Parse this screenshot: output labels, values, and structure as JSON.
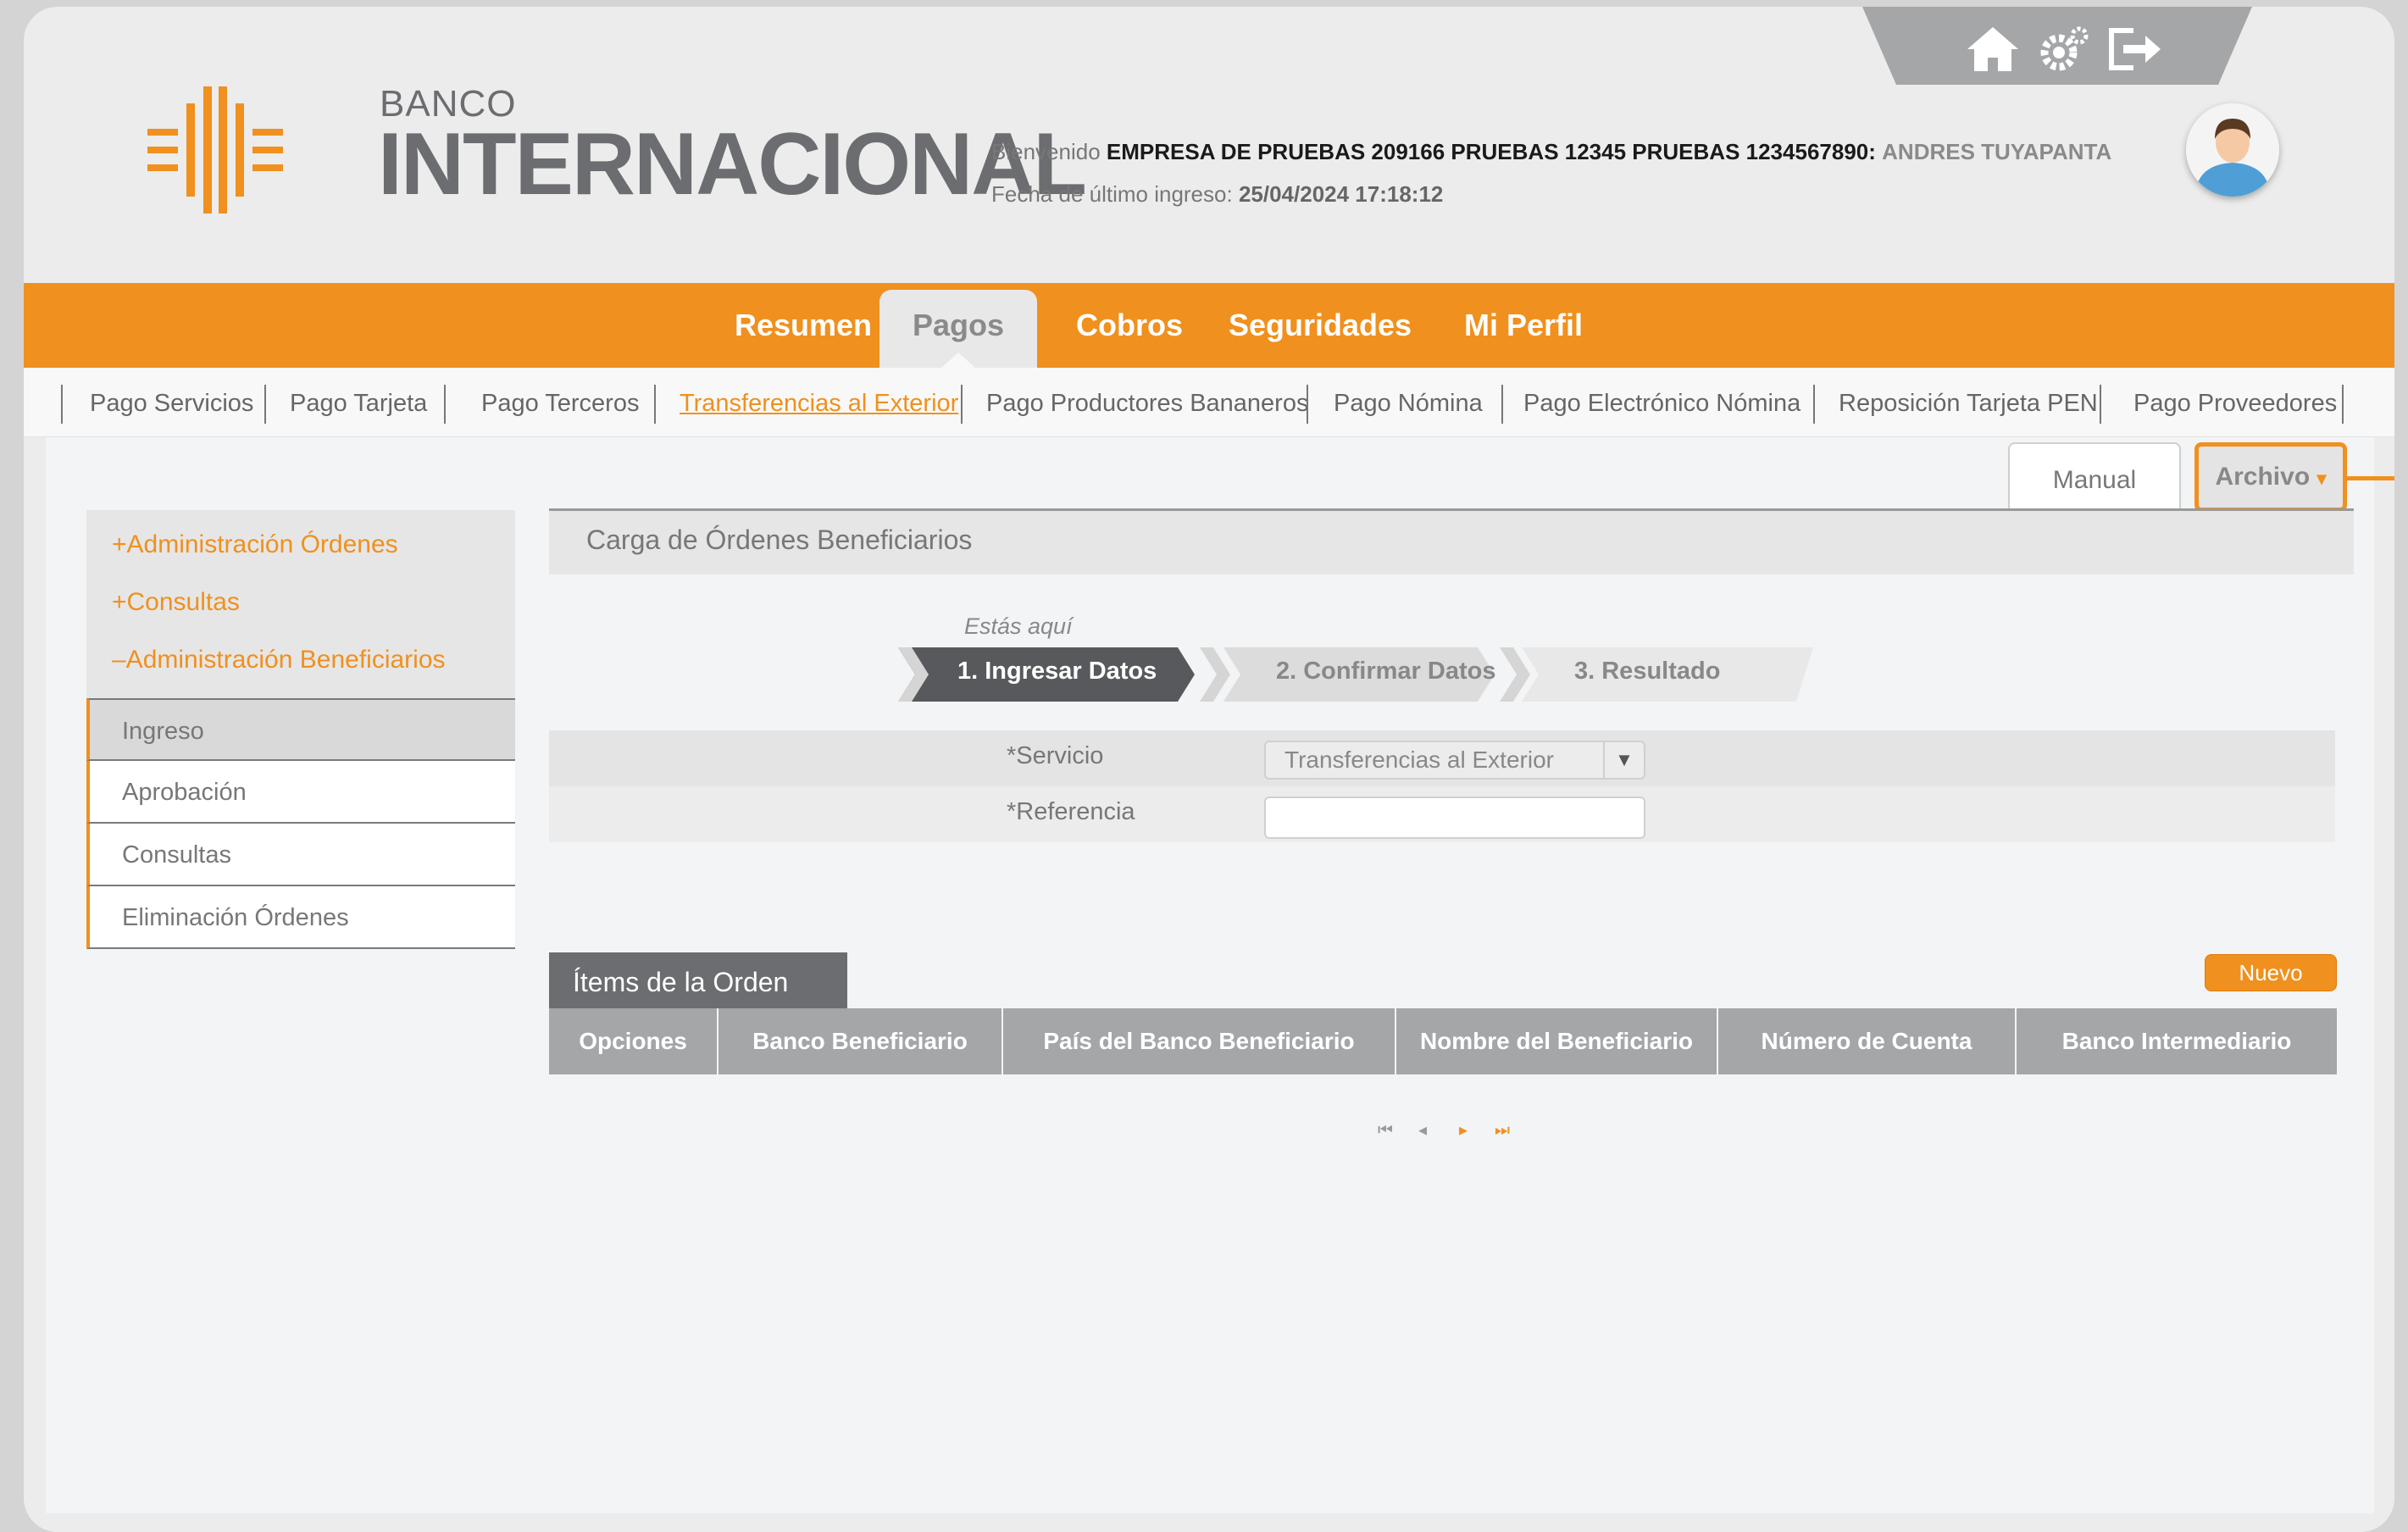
{
  "brand": {
    "line1": "BANCO",
    "line2": "INTERNACIONAL",
    "color_orange": "#f0901e",
    "color_gray": "#6c6d70"
  },
  "header": {
    "welcome_prefix": "Bienvenido",
    "company": "EMPRESA DE PRUEBAS 209166 PRUEBAS 12345 PRUEBAS 1234567890:",
    "user": "ANDRES TUYAPANTA",
    "last_login_label": "Fecha de último ingreso:",
    "last_login_value": "25/04/2024 17:18:12",
    "icons": [
      "home-icon",
      "settings-icon",
      "logout-icon"
    ]
  },
  "main_nav": {
    "items": [
      "Resumen",
      "Pagos",
      "Cobros",
      "Seguridades",
      "Mi Perfil"
    ],
    "active": "Pagos"
  },
  "sub_nav": {
    "items": [
      "Pago Servicios",
      "Pago Tarjeta",
      "Pago Terceros",
      "Transferencias al Exterior",
      "Pago Productores Bananeros",
      "Pago Nómina",
      "Pago Electrónico Nómina",
      "Reposición Tarjeta PEN",
      "Pago Proveedores"
    ],
    "active": "Transferencias al Exterior"
  },
  "tabs": {
    "manual": "Manual",
    "archivo": "Archivo",
    "archivo_caret": "▾"
  },
  "sidebar": {
    "sections": [
      "+Administración Órdenes",
      "+Consultas",
      "–Administración Beneficiarios"
    ],
    "menu": [
      "Ingreso",
      "Aprobación",
      "Consultas",
      "Eliminación Órdenes"
    ],
    "selected": "Ingreso"
  },
  "content": {
    "title": "Carga de Órdenes Beneficiarios",
    "here_label": "Estás aquí",
    "steps": [
      "1. Ingresar Datos",
      "2. Confirmar Datos",
      "3. Resultado"
    ],
    "active_step": 1,
    "form": {
      "servicio_label": "*Servicio",
      "servicio_value": "Transferencias al Exterior",
      "servicio_arrow": "▼",
      "referencia_label": "*Referencia",
      "referencia_value": ""
    },
    "items_title": "Ítems de la Orden",
    "new_button": "Nuevo",
    "table_headers": [
      "Opciones",
      "Banco Beneficiario",
      "País del Banco Beneficiario",
      "Nombre del Beneficiario",
      "Número de Cuenta",
      "Banco Intermediario"
    ],
    "pager": {
      "first": "⏮",
      "prev": "◂",
      "next": "▸",
      "last": "⏭"
    }
  }
}
